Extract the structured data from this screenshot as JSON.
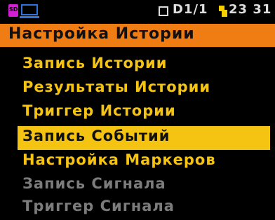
{
  "status_bar": {
    "sd_icon": "sd-card-icon",
    "display_icon": "monitor-icon",
    "channel_text": "D1/1",
    "time_text": "23 31",
    "battery_icon": "battery-icon"
  },
  "menu": {
    "title": "Настройка Истории",
    "items": [
      {
        "label": "Запись Истории",
        "state": "enabled"
      },
      {
        "label": "Результаты Истории",
        "state": "enabled"
      },
      {
        "label": "Триггер Истории",
        "state": "enabled"
      },
      {
        "label": "Запись Событий",
        "state": "selected"
      },
      {
        "label": "Настройка Маркеров",
        "state": "enabled"
      },
      {
        "label": "Запись Сигнала",
        "state": "disabled"
      },
      {
        "label": "Триггер Сигнала",
        "state": "disabled"
      }
    ]
  },
  "colors": {
    "title_bg": "#ef7d14",
    "item_text": "#f5c312",
    "selected_bg": "#f5c312",
    "disabled_text": "#7c7c7c",
    "background": "#000000"
  }
}
